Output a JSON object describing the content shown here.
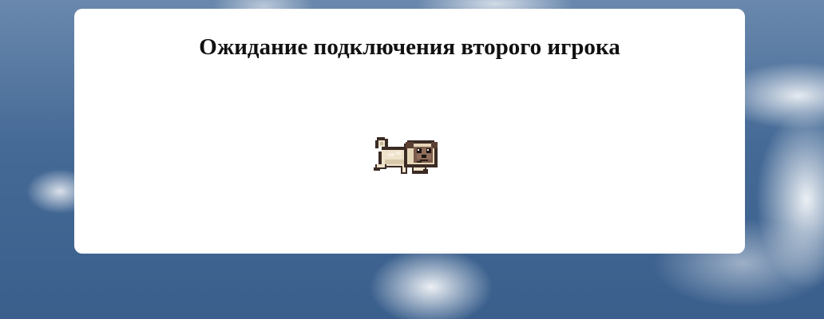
{
  "dialog": {
    "title": "Ожидание подключения второго игрока",
    "loading_icon": "running-pug-icon"
  }
}
